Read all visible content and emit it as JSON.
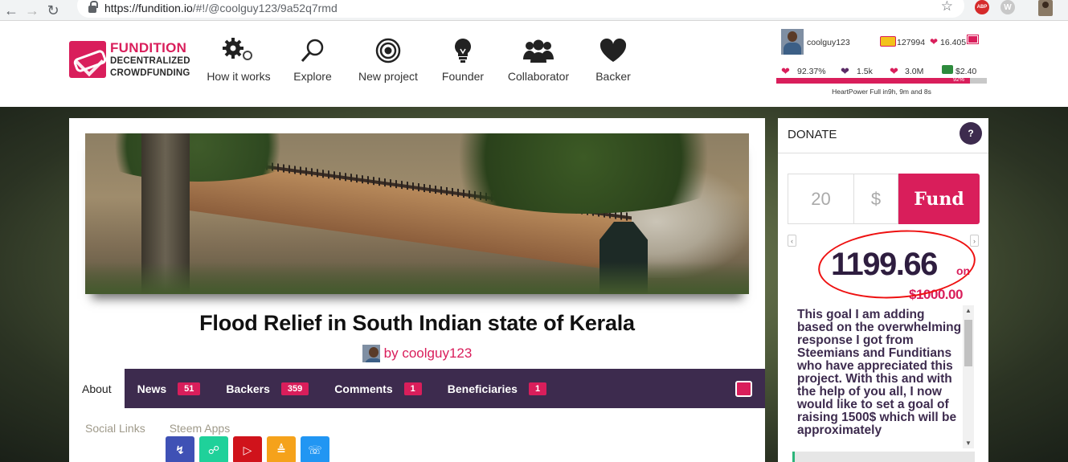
{
  "browser": {
    "url_host": "https://fundition.io",
    "url_path": "/#!/@coolguy123/9a52q7rmd",
    "abp_label": "ABP"
  },
  "logo": {
    "line1": "FUNDITION",
    "line2": "DECENTRALIZED",
    "line3": "CROWDFUNDING"
  },
  "nav": [
    {
      "label": "How it works",
      "icon": "gears-icon"
    },
    {
      "label": "Explore",
      "icon": "magnifier-icon"
    },
    {
      "label": "New project",
      "icon": "target-icon"
    },
    {
      "label": "Founder",
      "icon": "lightbulb-icon"
    },
    {
      "label": "Collaborator",
      "icon": "group-icon"
    },
    {
      "label": "Backer",
      "icon": "heart-icon"
    }
  ],
  "user": {
    "name": "coolguy123",
    "coins": "127994",
    "hearts": "16.405",
    "reputation": "92.37%",
    "followers": "1.5k",
    "power": "3.0M",
    "wallet": "$2.40",
    "bar_percent": 92,
    "bar_label": "92%",
    "heartpower": "HeartPower Full in9h, 9m and 8s"
  },
  "project": {
    "title": "Flood Relief in South Indian state of Kerala",
    "by": "by coolguy123"
  },
  "tabs": [
    {
      "label": "About",
      "badge": null
    },
    {
      "label": "News",
      "badge": "51"
    },
    {
      "label": "Backers",
      "badge": "359"
    },
    {
      "label": "Comments",
      "badge": "1"
    },
    {
      "label": "Beneficiaries",
      "badge": "1"
    }
  ],
  "subtabs": {
    "social": "Social Links",
    "apps": "Steem Apps"
  },
  "steem_apps": [
    {
      "icon": "bolt-icon",
      "color": "#3f51b5"
    },
    {
      "icon": "busy-icon",
      "color": "#1fd19a"
    },
    {
      "icon": "dtube-icon",
      "color": "#d0131b"
    },
    {
      "icon": "dlive-icon",
      "color": "#f5a21b"
    },
    {
      "icon": "steemit-icon",
      "color": "#2196f3"
    }
  ],
  "donate": {
    "header": "DONATE",
    "help": "?",
    "amount": "20",
    "currency": "$",
    "fund_label": "Fund",
    "raised": "1199.66",
    "on": "on",
    "goal": "$1000.00",
    "description": "This goal I am adding based on the overwhelming response I got from Steemians and Funditians who have appreciated this project. With this and with the help of you all, I now would like to set a goal of raising 1500$ which will be approximately"
  },
  "colors": {
    "brand": "#d91e5b",
    "nav_dark": "#3d2b4e"
  }
}
